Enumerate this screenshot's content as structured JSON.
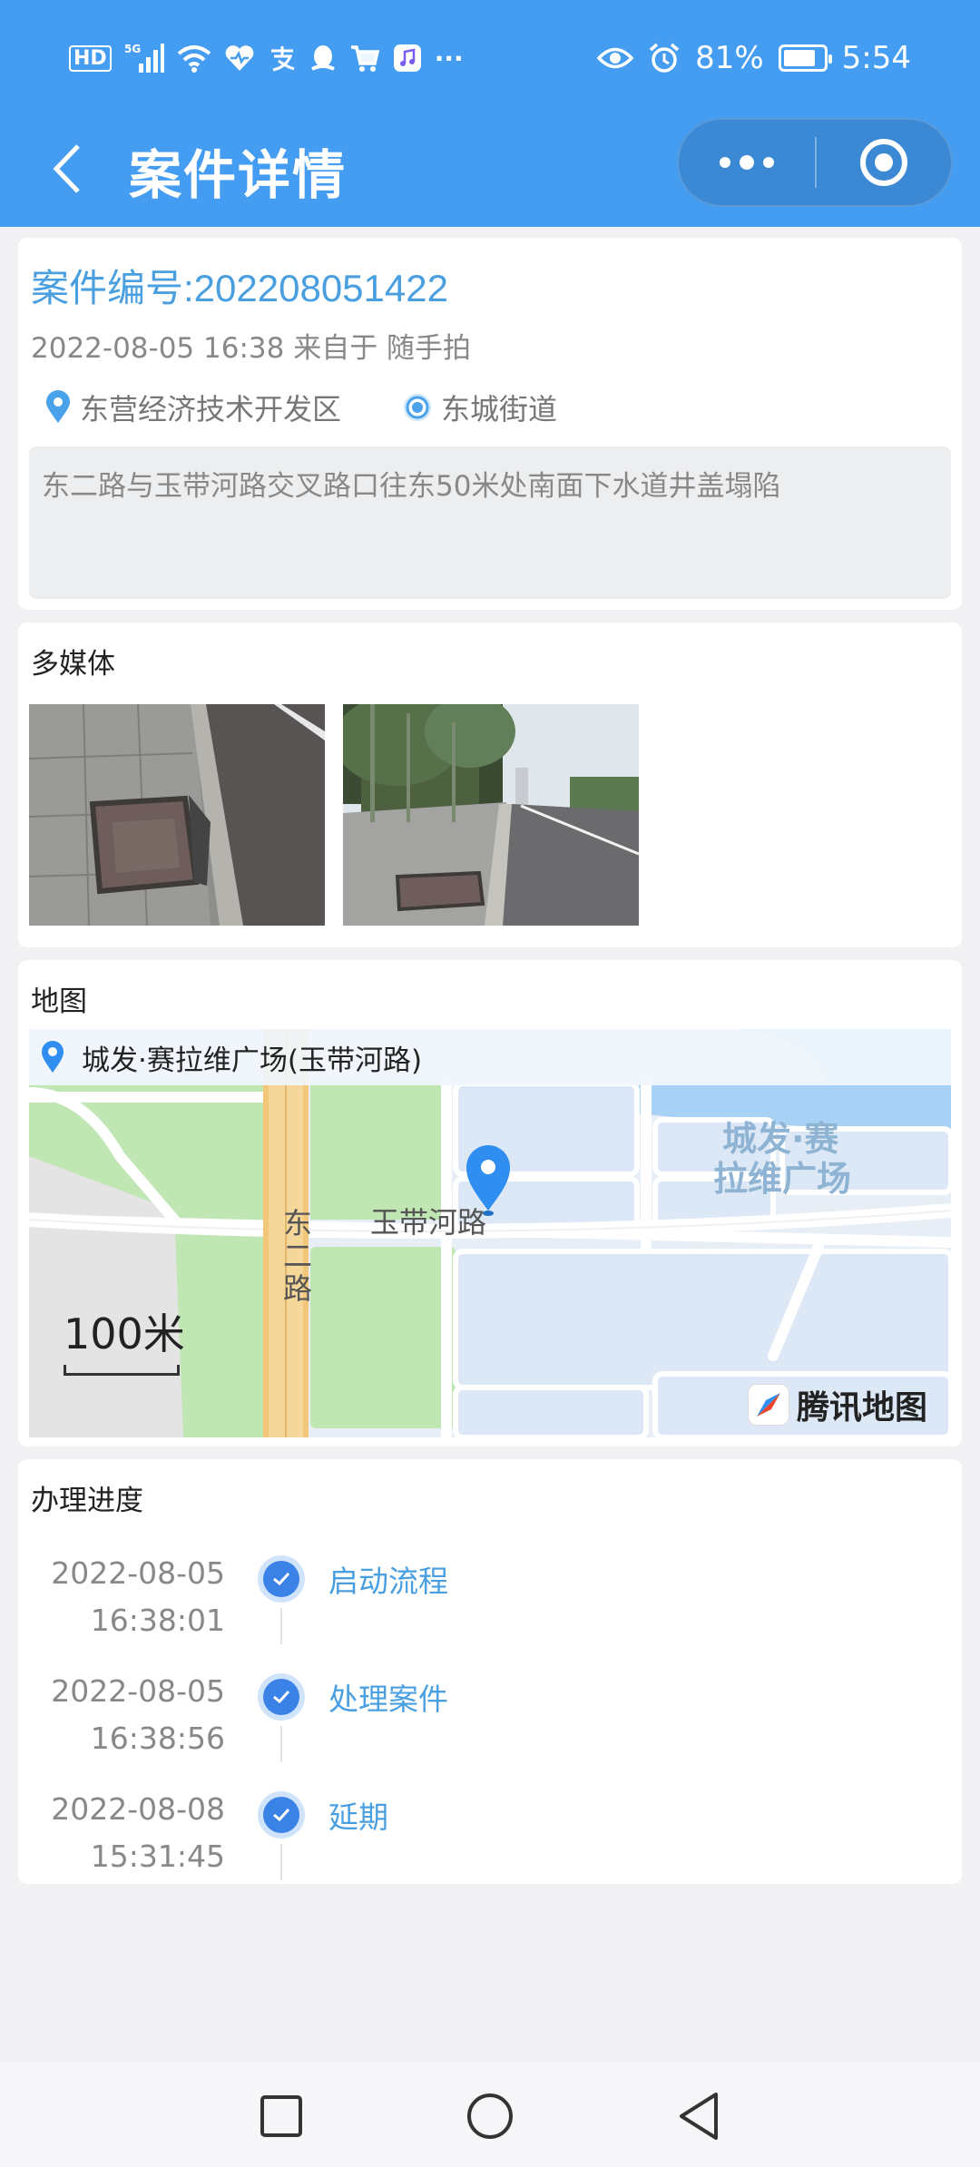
{
  "status_bar": {
    "left_icons": [
      "hd-icon",
      "5g-signal-icon",
      "wifi-icon",
      "health-icon",
      "alipay-icon",
      "qq-icon",
      "shopping-cart-icon",
      "music-icon",
      "more-dots-icon"
    ],
    "hd": "HD",
    "network": "5G",
    "more": "···",
    "battery_percent": "81%",
    "battery_level": 0.81,
    "time": "5:54"
  },
  "navbar": {
    "title": "案件详情",
    "back_icon": "chevron-left-icon",
    "more_icon": "more-dots-icon",
    "close_icon": "target-close-icon"
  },
  "case": {
    "number_text": "案件编号:202208051422",
    "meta_text": "2022-08-05 16:38 来自于 随手拍",
    "district": "东营经济技术开发区",
    "street": "东城街道",
    "description": "东二路与玉带河路交叉路口往东50米处南面下水道井盖塌陷"
  },
  "media": {
    "title": "多媒体",
    "images": [
      "manhole-closeup-photo",
      "roadside-overview-photo"
    ]
  },
  "map": {
    "title": "地图",
    "address": "城发·赛拉维广场(玉带河路)",
    "road_label_main": "玉带河路",
    "road_label_vertical": "东二路",
    "poi_label_line1": "城发·赛",
    "poi_label_line2": "拉维广场",
    "scale": "100米",
    "provider": "腾讯地图",
    "colors": {
      "water": "#a8d2f5",
      "green": "#bfe6b3",
      "road": "#f6d79a"
    }
  },
  "progress": {
    "title": "办理进度",
    "steps": [
      {
        "date": "2022-08-05",
        "time": "16:38:01",
        "label": "启动流程"
      },
      {
        "date": "2022-08-05",
        "time": "16:38:56",
        "label": "处理案件"
      },
      {
        "date": "2022-08-08",
        "time": "15:31:45",
        "label": "延期"
      }
    ]
  },
  "system_nav": {
    "buttons": [
      "recent-apps-square-icon",
      "home-circle-icon",
      "back-triangle-icon"
    ]
  },
  "colors": {
    "primary": "#459df2",
    "link": "#4a9fe0",
    "check": "#3b82e6"
  }
}
